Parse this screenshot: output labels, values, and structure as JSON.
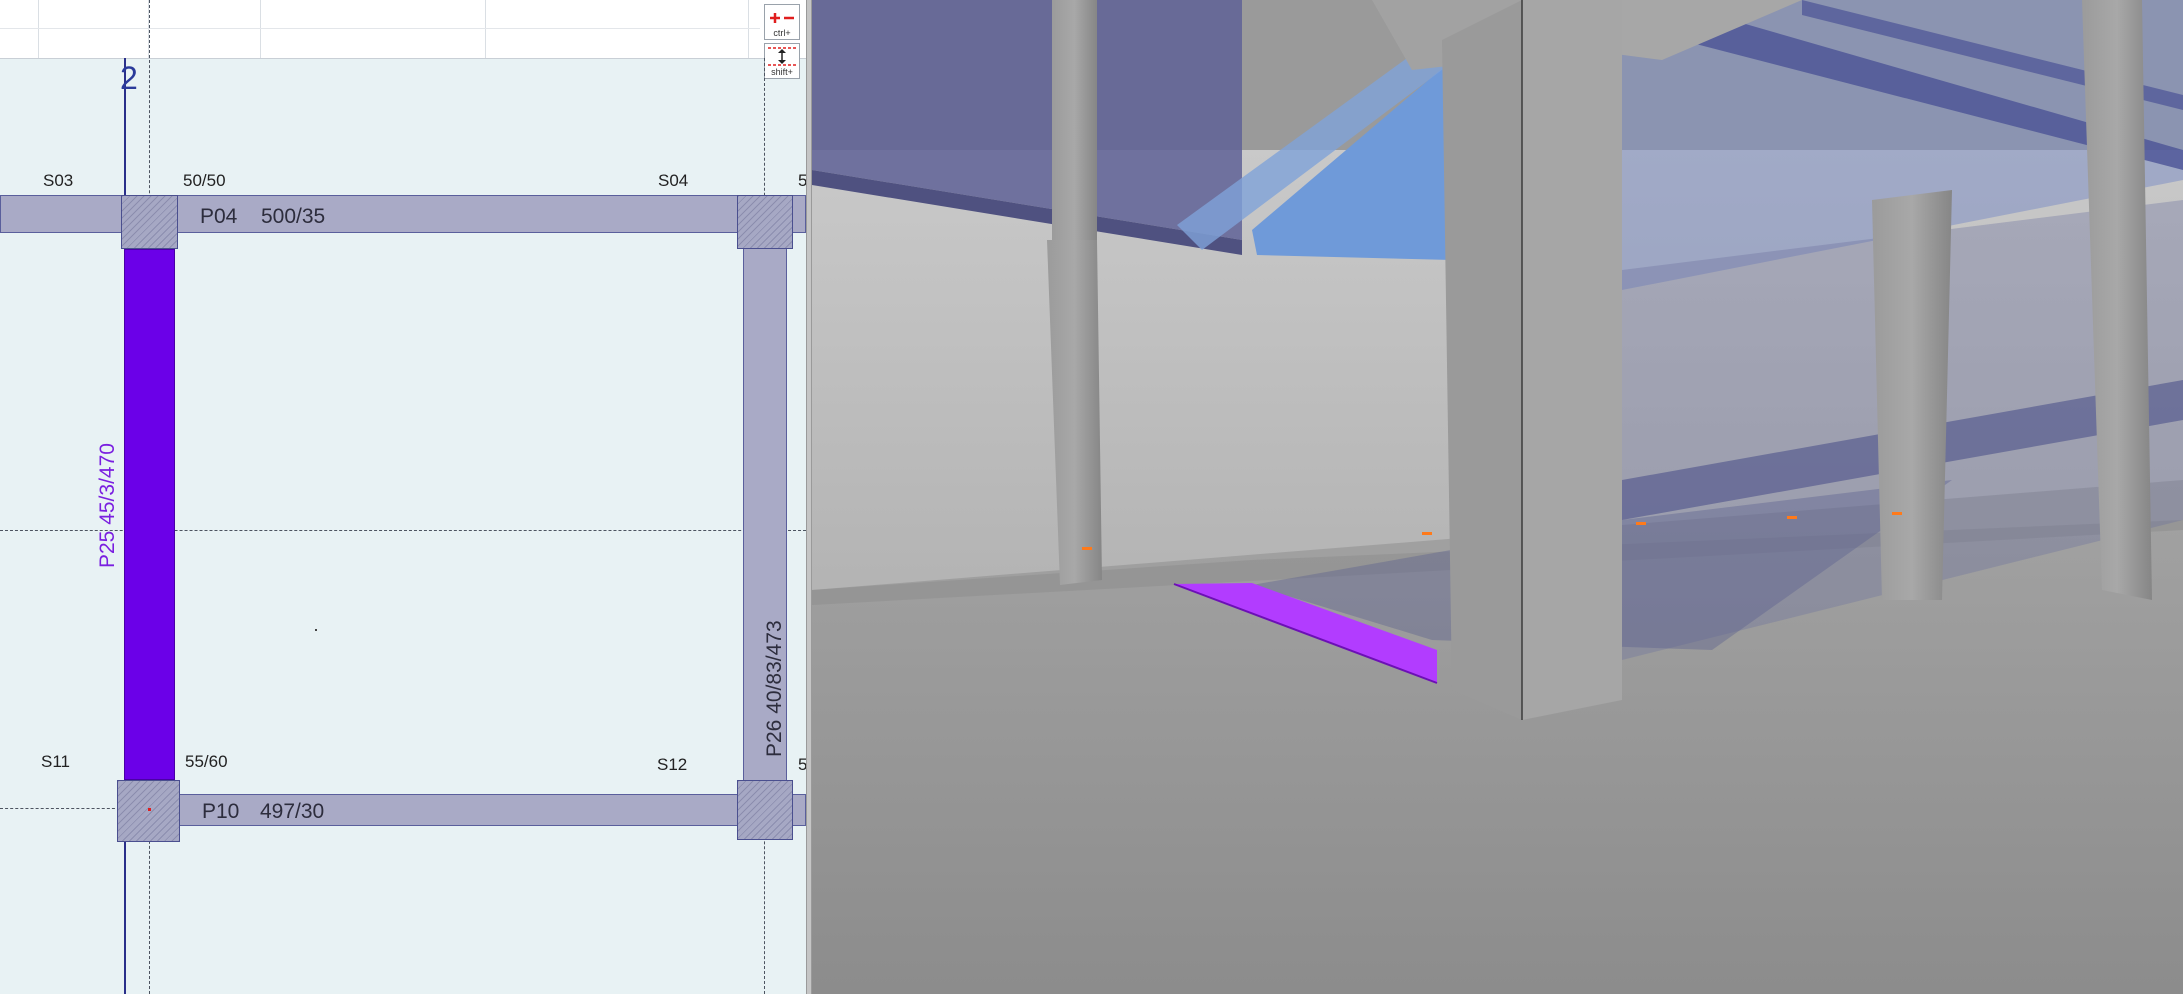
{
  "plan": {
    "axis_label": "2",
    "slabs": [
      {
        "id": "s03",
        "label": "S03"
      },
      {
        "id": "s04",
        "label": "S04"
      },
      {
        "id": "s11",
        "label": "S11"
      },
      {
        "id": "s12",
        "label": "S12"
      }
    ],
    "column_sizes": {
      "top_left": "50/50",
      "top_right_partial": "5",
      "bottom_left": "55/60",
      "bottom_right_partial": "5"
    },
    "beams": {
      "p04": {
        "name": "P04",
        "dims": "500/35"
      },
      "p10": {
        "name": "P10",
        "dims": "497/30"
      }
    },
    "walls": {
      "p25": {
        "label": "P25   45/3/470",
        "color": "#7a1fe0"
      },
      "p26": {
        "label": "P26   40/83/473",
        "color": "#2d2d3d"
      }
    },
    "tools": {
      "zoom": {
        "icon": "plus-minus-icon",
        "modifier": "ctrl+"
      },
      "move": {
        "icon": "vertical-move-icon",
        "modifier": "shift+"
      }
    }
  },
  "view3d": {
    "selected_color": "#b23cff",
    "sky_color": "#6f9ad9",
    "slab_color": "#5f6196"
  }
}
